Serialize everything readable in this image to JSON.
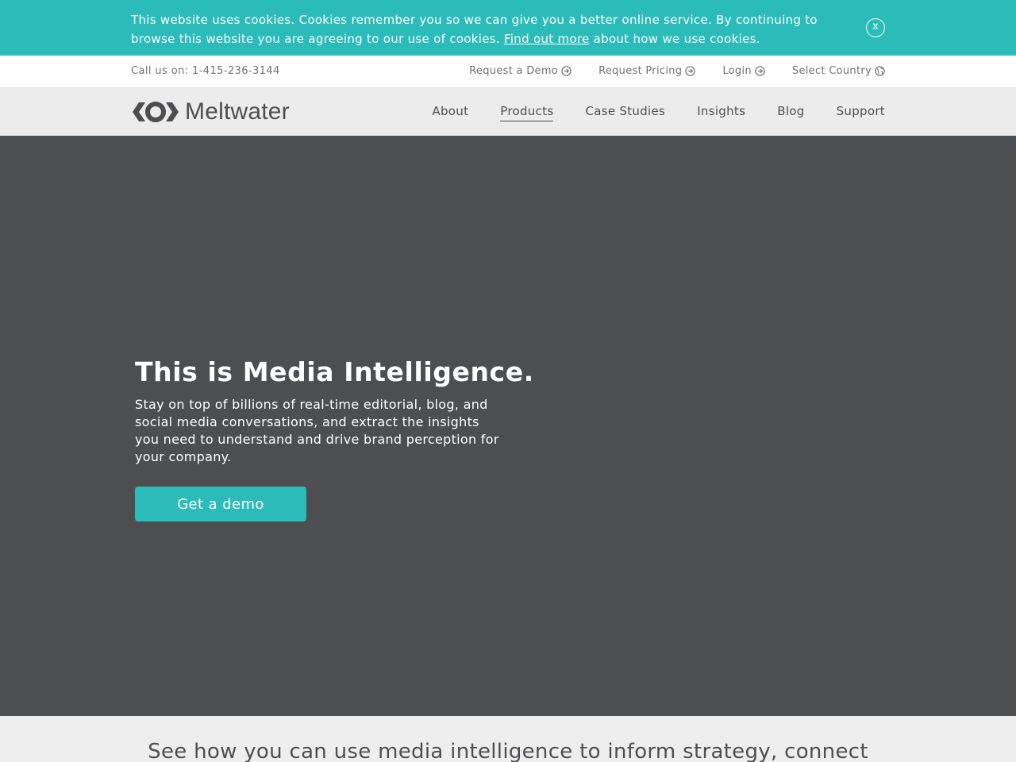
{
  "cookie_bar": {
    "text_before": "This website uses cookies. Cookies remember you so we can give you a better online service. By continuing to browse this website you are agreeing to our use of cookies. ",
    "link_label": "Find out more",
    "text_after": " about how we use cookies.",
    "close_label": "x",
    "background_color": "#2bbcba"
  },
  "utility_bar": {
    "phone": "Call us on: 1-415-236-3144",
    "links": [
      {
        "label": "Request a Demo",
        "icon": "arrow-circle-right-icon"
      },
      {
        "label": "Request Pricing",
        "icon": "arrow-circle-right-icon"
      },
      {
        "label": "Login",
        "icon": "arrow-circle-right-icon"
      },
      {
        "label": "Select Country",
        "icon": "globe-icon"
      }
    ]
  },
  "nav": {
    "logo_text": "Meltwater",
    "logo_icon": "meltwater-logo-icon",
    "items": [
      {
        "label": "About",
        "active": false
      },
      {
        "label": "Products",
        "active": true
      },
      {
        "label": "Case Studies",
        "active": false
      },
      {
        "label": "Insights",
        "active": false
      },
      {
        "label": "Blog",
        "active": false
      },
      {
        "label": "Support",
        "active": false
      }
    ]
  },
  "hero": {
    "title": "This is Media Intelligence.",
    "description": "Stay on top of billions of real-time editorial, blog, and social media conversations, and extract the insights you need to understand and drive brand perception for your company.",
    "cta_label": "Get a demo",
    "background_color": "#4d4e50",
    "accent_color": "#2bbcba"
  },
  "strategy": {
    "text": "See how you can use media intelligence to inform strategy, connect"
  }
}
